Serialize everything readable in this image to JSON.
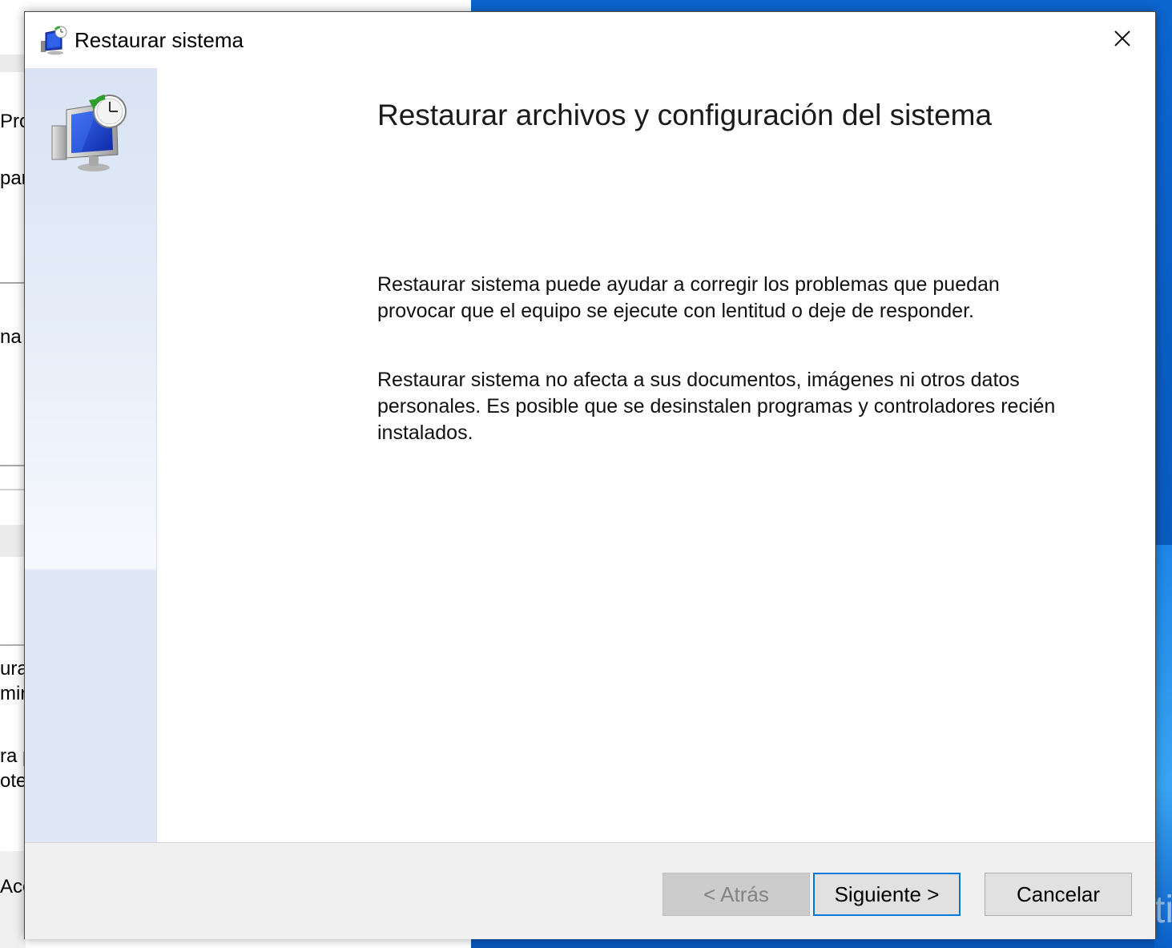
{
  "desktop": {
    "watermark": "Acti"
  },
  "background_window": {
    "fragments": [
      "Prot",
      "par",
      "na",
      "ura",
      "mir",
      "ra p",
      "otec",
      "Ace"
    ]
  },
  "dialog": {
    "title": "Restaurar sistema",
    "heading": "Restaurar archivos y configuración del sistema",
    "paragraph1": "Restaurar sistema puede ayudar a corregir los problemas que puedan provocar que el equipo se ejecute con lentitud o deje de responder.",
    "paragraph2": "Restaurar sistema no afecta a sus documentos, imágenes ni otros datos personales. Es posible que se desinstalen programas y controladores recién instalados.",
    "buttons": {
      "back": "< Atrás",
      "next": "Siguiente >",
      "cancel": "Cancelar"
    },
    "back_enabled": false,
    "icons": {
      "title": "system-restore-icon",
      "sidebar": "system-restore-large-icon",
      "close": "close-icon"
    },
    "colors": {
      "accent": "#0078d7",
      "sidebar": "#dfe7f5",
      "footer": "#f0f0f0"
    }
  }
}
